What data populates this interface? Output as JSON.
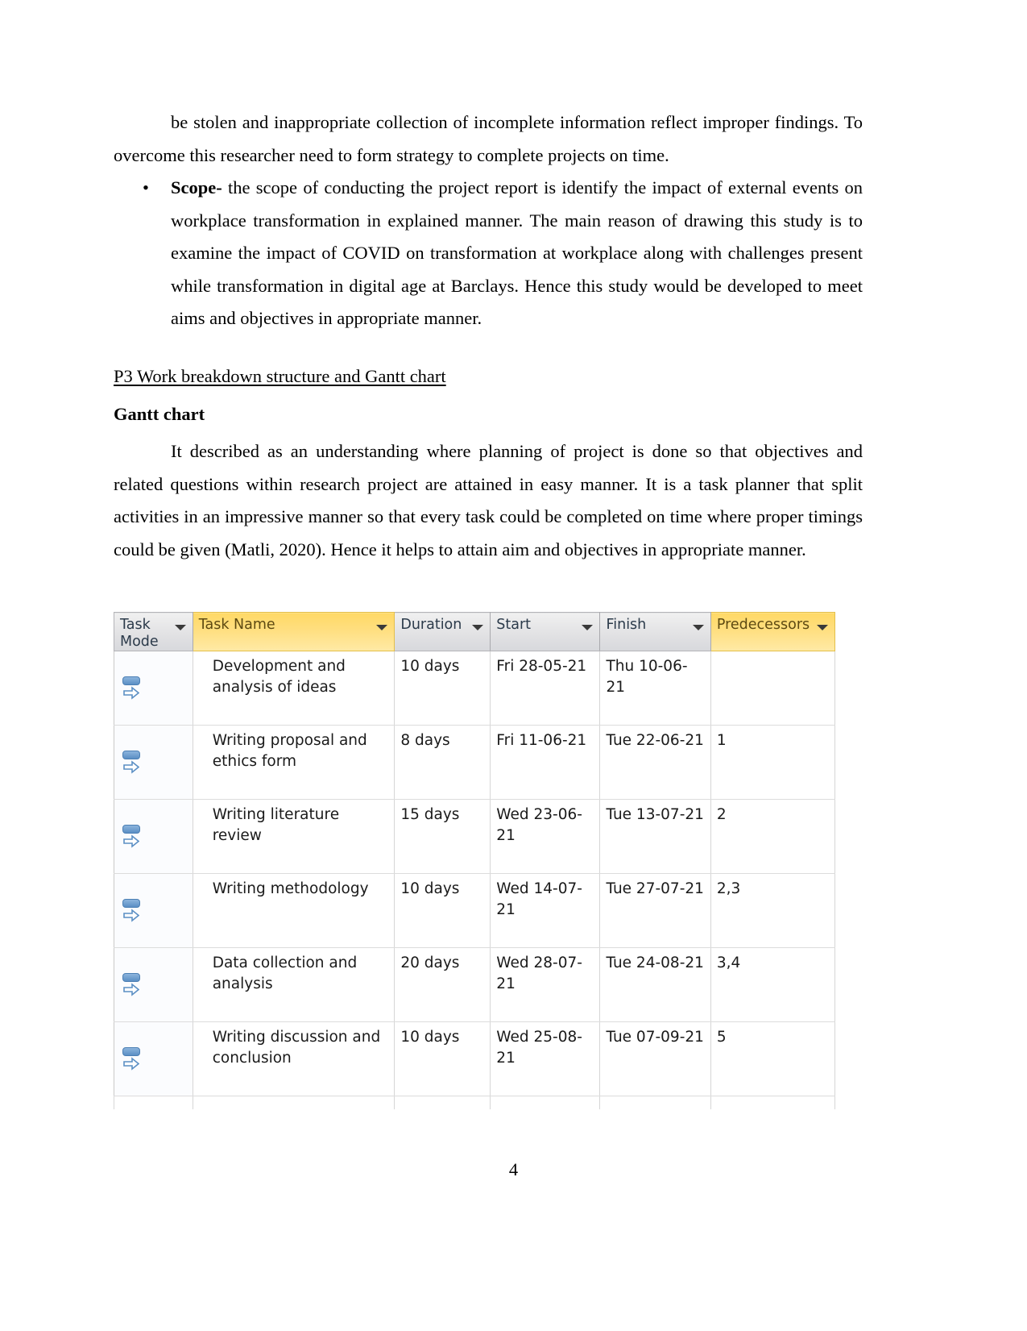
{
  "document": {
    "page_number": "4",
    "paragraphs": {
      "continued_text": "be stolen and inappropriate collection of incomplete information reflect improper findings. To overcome this researcher need to form strategy to complete projects on time.",
      "bullet_marker": "•",
      "bullet_label": "Scope-",
      "bullet_text": " the scope of conducting the project report is identify the impact of external events on workplace transformation in explained manner. The main reason of drawing this study is to examine the impact of COVID on transformation at workplace along with challenges present while transformation in digital age at Barclays. Hence this study would be developed to meet aims and objectives in appropriate manner.",
      "heading_p3": "P3 Work breakdown structure and Gantt chart",
      "heading_gantt": "Gantt chart",
      "gantt_description": "It described as an understanding where planning of project is done so that objectives and related questions within research project are attained in easy manner. It is a task planner that split activities in an impressive manner so that every task could be completed on time where proper timings could be given (Matli,  2020). Hence it helps to attain aim and objectives in appropriate manner."
    }
  },
  "gantt_table": {
    "columns": [
      {
        "key": "mode",
        "label": "Task\nMode",
        "selected": false,
        "has_filter": true
      },
      {
        "key": "name",
        "label": "Task Name",
        "selected": true,
        "has_filter": true
      },
      {
        "key": "dur",
        "label": "Duration",
        "selected": false,
        "has_filter": true
      },
      {
        "key": "start",
        "label": "Start",
        "selected": false,
        "has_filter": true
      },
      {
        "key": "finish",
        "label": "Finish",
        "selected": false,
        "has_filter": true
      },
      {
        "key": "pred",
        "label": "Predecessors",
        "selected": true,
        "has_filter": true
      }
    ],
    "mode_icon_name": "auto-scheduled-icon",
    "rows": [
      {
        "mode": "auto-scheduled",
        "name": "Development and analysis of ideas",
        "duration": "10 days",
        "start": "Fri 28-05-21",
        "finish": "Thu 10-06-21",
        "predecessors": ""
      },
      {
        "mode": "auto-scheduled",
        "name": "Writing proposal and ethics form",
        "duration": "8 days",
        "start": "Fri 11-06-21",
        "finish": "Tue 22-06-21",
        "predecessors": "1"
      },
      {
        "mode": "auto-scheduled",
        "name": "Writing literature review",
        "duration": "15 days",
        "start": "Wed 23-06-21",
        "finish": "Tue 13-07-21",
        "predecessors": "2"
      },
      {
        "mode": "auto-scheduled",
        "name": "Writing methodology",
        "duration": "10 days",
        "start": "Wed 14-07-21",
        "finish": "Tue 27-07-21",
        "predecessors": "2,3"
      },
      {
        "mode": "auto-scheduled",
        "name": "Data collection and analysis",
        "duration": "20 days",
        "start": "Wed 28-07-21",
        "finish": "Tue 24-08-21",
        "predecessors": "3,4"
      },
      {
        "mode": "auto-scheduled",
        "name": "Writing discussion and conclusion",
        "duration": "10 days",
        "start": "Wed 25-08-21",
        "finish": "Tue 07-09-21",
        "predecessors": "5"
      }
    ],
    "colors": {
      "header_default": "#dcdde1",
      "header_selected": "#ffd966",
      "grid_line": "#d6d6d6",
      "icon_blue": "#5b8fc4"
    }
  }
}
